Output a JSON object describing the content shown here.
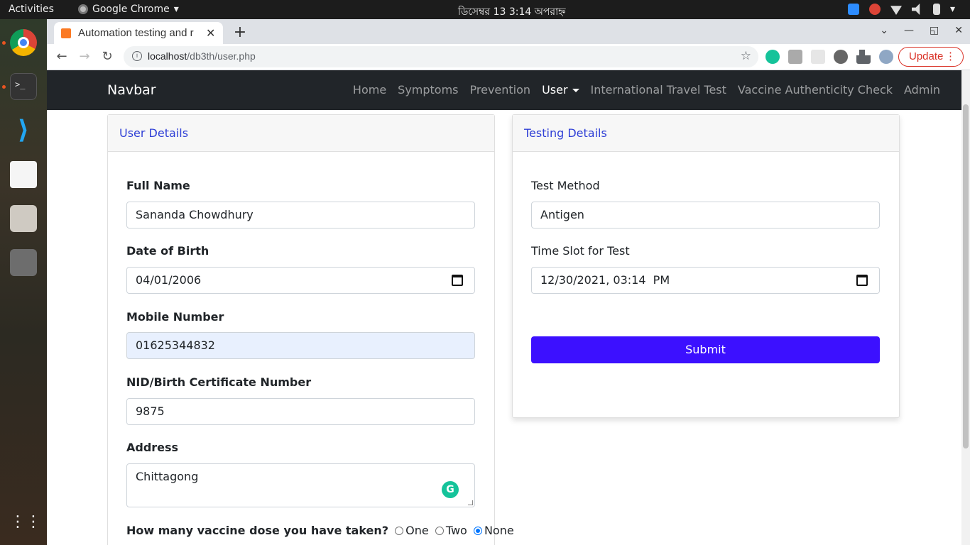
{
  "system": {
    "activities": "Activities",
    "app_name": "Google Chrome",
    "clock": "ডিসেম্বর 13   3:14 অপরাহ্ন"
  },
  "browser": {
    "tab_title": "Automation testing and r",
    "url_host": "localhost",
    "url_path": "/db3th/user.php",
    "update_label": "Update"
  },
  "navbar": {
    "brand": "Navbar",
    "links": [
      "Home",
      "Symptoms",
      "Prevention",
      "User",
      "International Travel Test",
      "Vaccine Authenticity Check",
      "Admin"
    ]
  },
  "user_details": {
    "header": "User Details",
    "full_name_label": "Full Name",
    "full_name_value": "Sananda Chowdhury",
    "dob_label": "Date of Birth",
    "dob_value": "04/01/2006",
    "mobile_label": "Mobile Number",
    "mobile_value": "01625344832",
    "nid_label": "NID/Birth Certificate Number",
    "nid_value": "9875",
    "address_label": "Address",
    "address_value": "Chittagong",
    "dose_question": "How many vaccine dose you have taken?",
    "dose_options": [
      "One",
      "Two",
      "None"
    ],
    "dose_selected": "None"
  },
  "testing_details": {
    "header": "Testing Details",
    "method_label": "Test Method",
    "method_value": "Antigen",
    "slot_label": "Time Slot for Test",
    "slot_value": "12/30/2021, 03:14  PM",
    "submit_label": "Submit"
  },
  "colors": {
    "navbar_bg": "#212529",
    "card_title": "#2f3fd6",
    "submit_bg": "#3c10ff",
    "autofill_bg": "#e8f0fe"
  }
}
